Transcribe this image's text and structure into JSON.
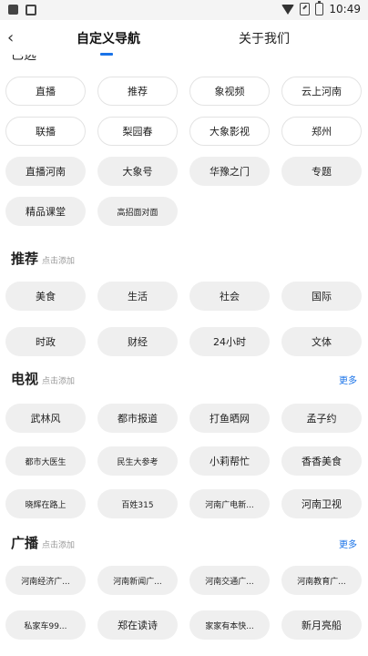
{
  "status_bar": {
    "time": "10:49"
  },
  "header": {
    "back_icon": "‹",
    "tab_custom": "自定义导航",
    "tab_about": "关于我们"
  },
  "selected": [
    "直播",
    "推荐",
    "象视频",
    "云上河南",
    "联播",
    "梨园春",
    "大象影视",
    "郑州",
    "直播河南",
    "大象号",
    "华豫之门",
    "专题",
    "精品课堂",
    "高招面对面"
  ],
  "recommend": {
    "title": "推荐",
    "hint": "点击添加",
    "items": [
      "美食",
      "生活",
      "社会",
      "国际",
      "时政",
      "财经",
      "24小时",
      "文体"
    ]
  },
  "tv": {
    "title": "电视",
    "hint": "点击添加",
    "more": "更多",
    "items": [
      "武林风",
      "都市报道",
      "打鱼晒网",
      "孟子约",
      "都市大医生",
      "民生大参考",
      "小莉帮忙",
      "香香美食",
      "晓辉在路上",
      "百姓315",
      "河南广电新...",
      "河南卫视"
    ]
  },
  "radio": {
    "title": "广播",
    "hint": "点击添加",
    "more": "更多",
    "items": [
      "河南经济广...",
      "河南新闻广...",
      "河南交通广...",
      "河南教育广...",
      "私家车99...",
      "郑在读诗",
      "家家有本快...",
      "新月亮船"
    ]
  }
}
